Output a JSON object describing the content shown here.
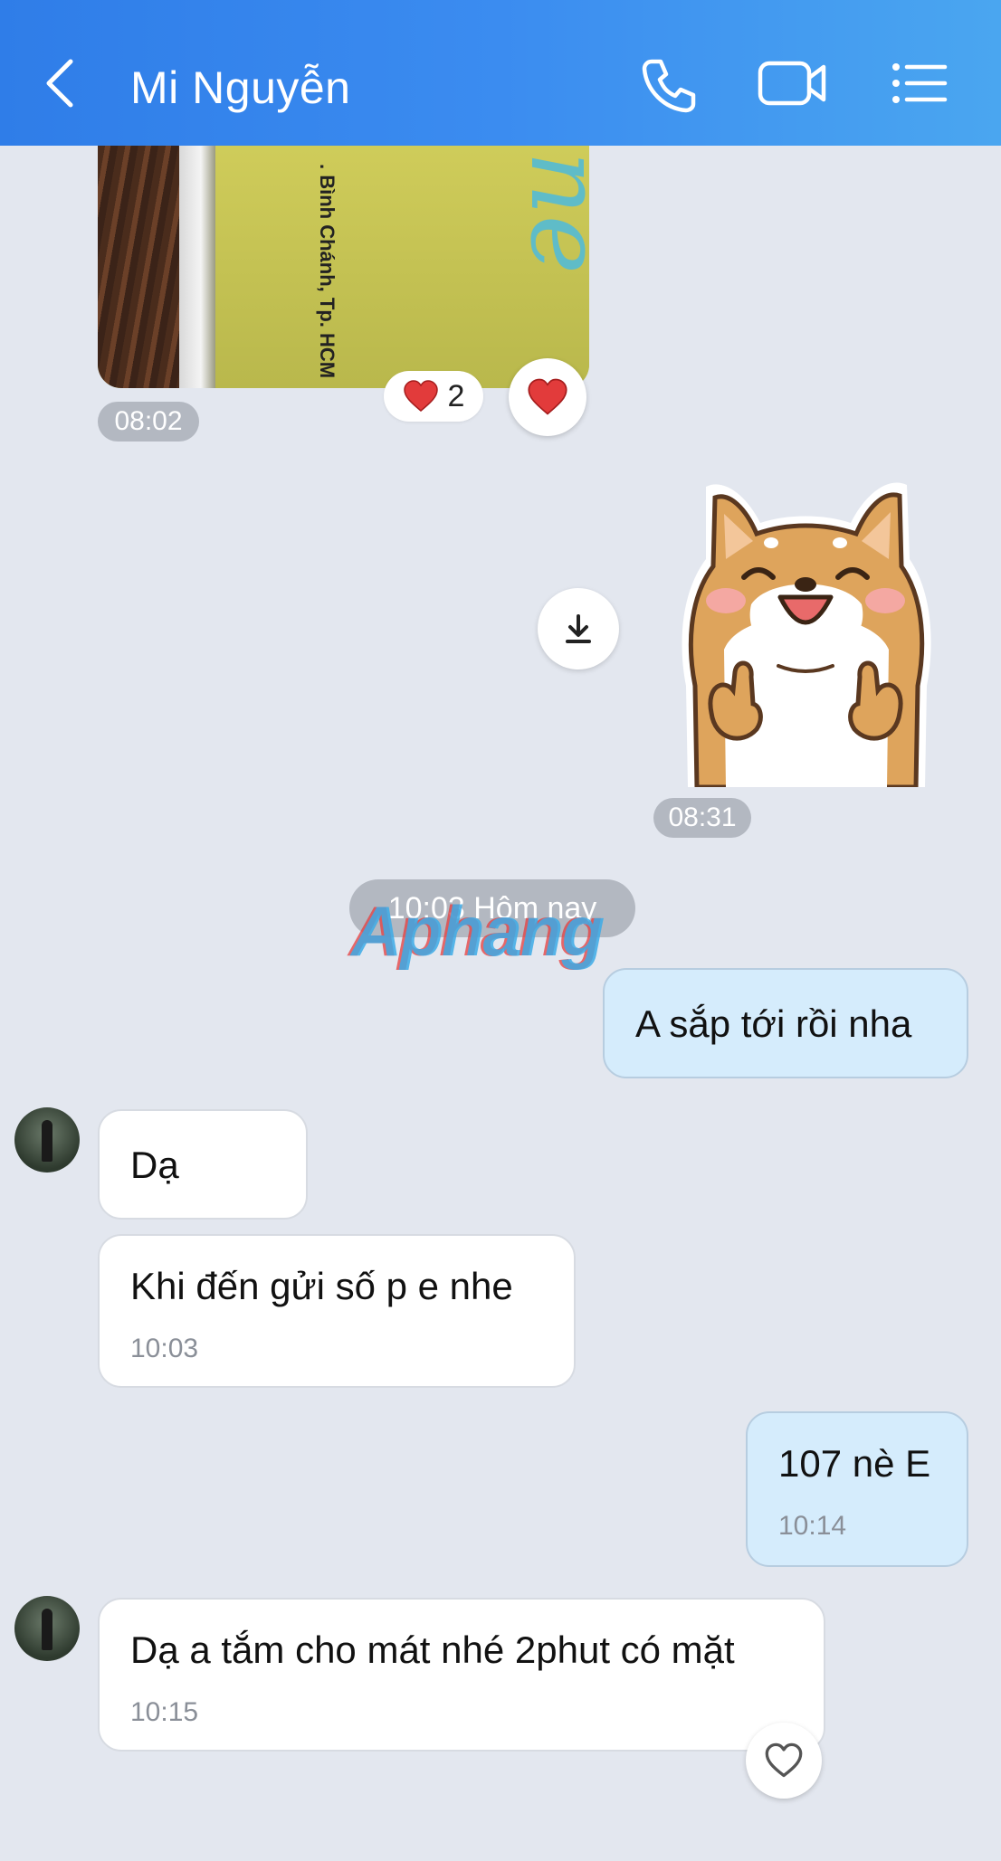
{
  "header": {
    "title": "Mi Nguyễn",
    "icons": [
      "back-icon",
      "phone-icon",
      "video-icon",
      "menu-icon"
    ]
  },
  "messages": {
    "photo": {
      "caption_text": ". Bình Chánh, Tp. HCM",
      "reaction_count": "2",
      "time": "08:02"
    },
    "sticker": {
      "time": "08:31"
    },
    "date_separator": "10:03 Hôm nay",
    "watermark": "Aphang",
    "m1": {
      "text": "A sắp tới rồi nha"
    },
    "m2": {
      "text": "Dạ"
    },
    "m3": {
      "text": "Khi đến gửi số p e nhe",
      "time": "10:03"
    },
    "m4": {
      "text": "107 nè E",
      "time": "10:14"
    },
    "m5": {
      "text": "Dạ a tắm cho mát nhé 2phut có mặt",
      "time": "10:15"
    }
  },
  "colors": {
    "header_start": "#2f7de8",
    "header_end": "#4aa6f0",
    "background": "#e3e7ef",
    "outgoing_bubble": "#d5ecfc",
    "incoming_bubble": "#ffffff",
    "heart": "#e23b3b"
  }
}
